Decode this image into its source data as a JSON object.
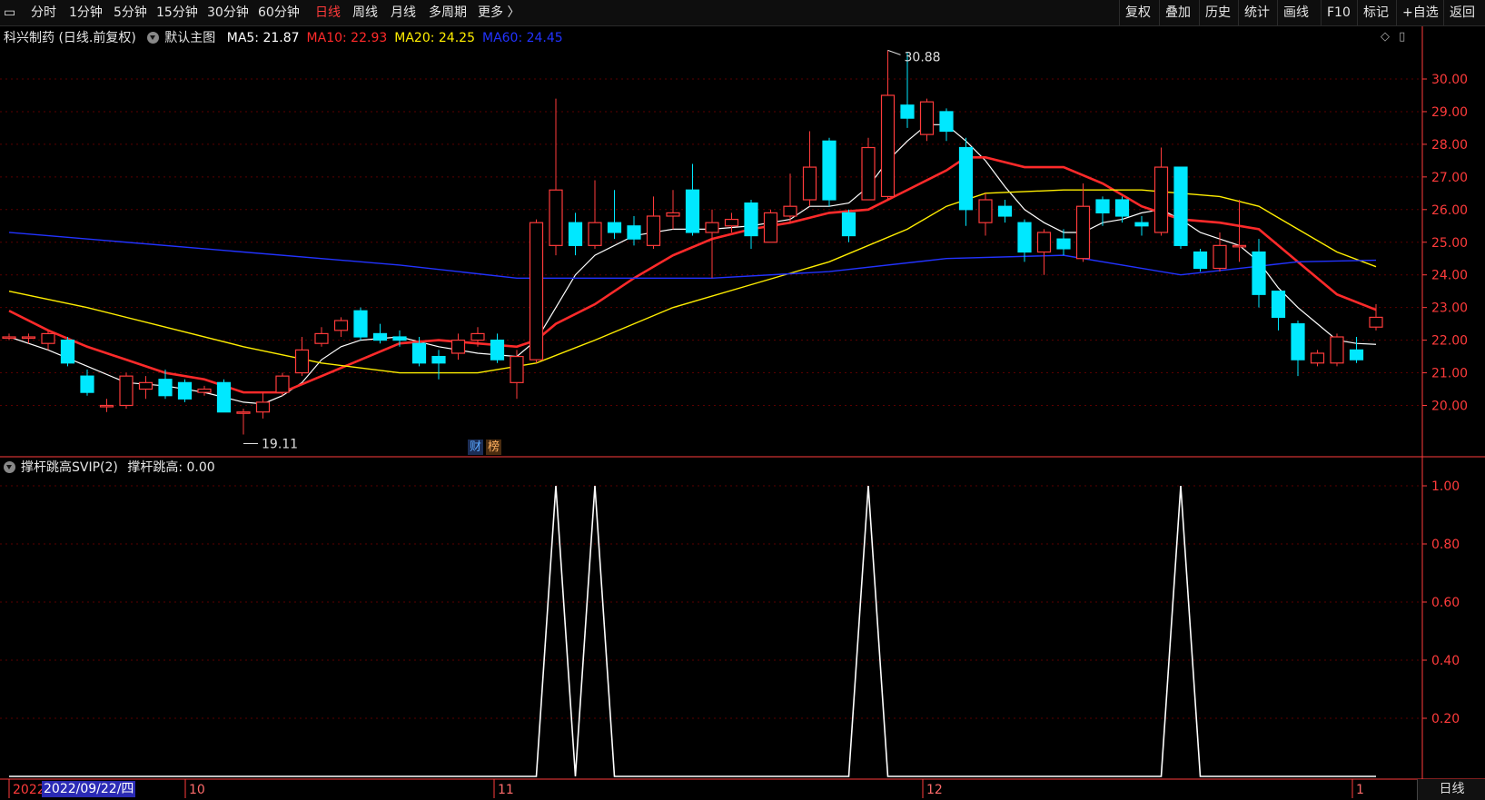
{
  "toolbar": {
    "periods": [
      {
        "label": "分时",
        "active": false
      },
      {
        "label": "1分钟",
        "active": false
      },
      {
        "label": "5分钟",
        "active": false
      },
      {
        "label": "15分钟",
        "active": false
      },
      {
        "label": "30分钟",
        "active": false
      },
      {
        "label": "60分钟",
        "active": false
      },
      {
        "label": "日线",
        "active": true
      },
      {
        "label": "周线",
        "active": false
      },
      {
        "label": "月线",
        "active": false
      },
      {
        "label": "多周期",
        "active": false
      },
      {
        "label": "更多 〉",
        "active": false
      }
    ],
    "actions": [
      "复权",
      "叠加",
      "历史",
      "统计",
      "画线",
      "F10",
      "标记",
      "+自选",
      "返回"
    ]
  },
  "main_panel": {
    "stock_title": "科兴制药 (日线.前复权)",
    "template": "默认主图",
    "indicators": [
      {
        "text": "MA5: 21.87",
        "color": "#ffffff"
      },
      {
        "text": "MA10: 22.93",
        "color": "#ff2a2a"
      },
      {
        "text": "MA20: 24.25",
        "color": "#ffee00"
      },
      {
        "text": "MA60: 24.45",
        "color": "#2233ff"
      }
    ],
    "high_label": "30.88",
    "low_label": "19.11",
    "badges": [
      {
        "text": "财",
        "color": "#3399ff"
      },
      {
        "text": "榜",
        "color": "#ff9933"
      }
    ]
  },
  "sub_panel": {
    "title": "撑杆跳高SVIP(2)",
    "value_text": "撑杆跳高: 0.00"
  },
  "x_axis": {
    "labels": [
      "2022",
      "10",
      "11",
      "12",
      "1"
    ],
    "cursor_date": "2022/09/22/四",
    "period_tag": "日线"
  },
  "colors": {
    "up": "#ff3b3b",
    "down": "#00e8ff",
    "ma5": "#ffffff",
    "ma10": "#ff2a2a",
    "ma20": "#ffee00",
    "ma60": "#2233ff",
    "grid": "#5a0000",
    "axis": "#ff3b3b"
  },
  "chart_data": [
    {
      "type": "candlestick",
      "title": "科兴制药 (日线.前复权)",
      "ylim": [
        19.0,
        31.0
      ],
      "y_ticks": [
        20.0,
        21.0,
        22.0,
        23.0,
        24.0,
        25.0,
        26.0,
        27.0,
        28.0,
        29.0,
        30.0
      ],
      "candles": [
        [
          22.1,
          22.1,
          22.2,
          22.0
        ],
        [
          22.1,
          22.1,
          22.2,
          21.9
        ],
        [
          21.9,
          22.2,
          22.3,
          21.7
        ],
        [
          22.0,
          21.3,
          22.1,
          21.2
        ],
        [
          20.9,
          20.4,
          21.1,
          20.3
        ],
        [
          20.0,
          20.0,
          20.2,
          19.8
        ],
        [
          20.0,
          20.9,
          21.0,
          19.9
        ],
        [
          20.5,
          20.7,
          20.9,
          20.2
        ],
        [
          20.8,
          20.3,
          21.1,
          20.2
        ],
        [
          20.7,
          20.2,
          20.8,
          20.1
        ],
        [
          20.4,
          20.5,
          20.6,
          20.3
        ],
        [
          20.7,
          19.8,
          20.8,
          19.8
        ],
        [
          19.8,
          19.8,
          19.9,
          19.11
        ],
        [
          19.8,
          20.1,
          20.4,
          19.6
        ],
        [
          20.4,
          20.9,
          21.0,
          20.3
        ],
        [
          21.0,
          21.7,
          22.1,
          20.9
        ],
        [
          21.9,
          22.2,
          22.4,
          21.8
        ],
        [
          22.3,
          22.6,
          22.7,
          22.1
        ],
        [
          22.9,
          22.1,
          23.0,
          22.0
        ],
        [
          22.2,
          22.0,
          22.5,
          21.9
        ],
        [
          22.1,
          22.0,
          22.3,
          21.8
        ],
        [
          21.9,
          21.3,
          22.1,
          21.2
        ],
        [
          21.5,
          21.3,
          21.7,
          20.8
        ],
        [
          21.6,
          22.0,
          22.2,
          21.4
        ],
        [
          22.0,
          22.2,
          22.4,
          21.8
        ],
        [
          22.0,
          21.4,
          22.2,
          21.3
        ],
        [
          20.7,
          21.5,
          21.7,
          20.2
        ],
        [
          21.4,
          25.6,
          25.7,
          21.3
        ],
        [
          24.9,
          26.6,
          29.4,
          24.6
        ],
        [
          25.6,
          24.9,
          25.9,
          24.6
        ],
        [
          24.9,
          25.6,
          26.9,
          24.8
        ],
        [
          25.6,
          25.3,
          26.6,
          25.1
        ],
        [
          25.5,
          25.1,
          25.8,
          24.9
        ],
        [
          24.9,
          25.8,
          26.4,
          24.8
        ],
        [
          25.8,
          25.9,
          26.6,
          25.4
        ],
        [
          26.6,
          25.3,
          27.4,
          25.2
        ],
        [
          25.3,
          25.6,
          26.0,
          23.9
        ],
        [
          25.5,
          25.7,
          25.9,
          25.3
        ],
        [
          26.2,
          25.2,
          26.3,
          24.8
        ],
        [
          25.0,
          25.9,
          26.0,
          25.0
        ],
        [
          25.8,
          26.1,
          27.1,
          25.6
        ],
        [
          26.3,
          27.3,
          28.4,
          26.1
        ],
        [
          28.1,
          26.3,
          28.2,
          26.1
        ],
        [
          25.9,
          25.2,
          26.0,
          25.0
        ],
        [
          26.3,
          27.9,
          28.2,
          26.3
        ],
        [
          26.4,
          29.5,
          30.88,
          26.3
        ],
        [
          29.2,
          28.8,
          30.8,
          28.5
        ],
        [
          28.3,
          29.3,
          29.4,
          28.1
        ],
        [
          29.0,
          28.4,
          29.1,
          28.1
        ],
        [
          27.9,
          26.0,
          28.2,
          25.5
        ],
        [
          25.6,
          26.3,
          26.5,
          25.2
        ],
        [
          26.1,
          25.8,
          26.3,
          25.6
        ],
        [
          25.6,
          24.7,
          25.7,
          24.4
        ],
        [
          24.7,
          25.3,
          25.4,
          24.0
        ],
        [
          25.1,
          24.8,
          25.4,
          24.6
        ],
        [
          24.5,
          26.1,
          26.8,
          24.4
        ],
        [
          26.3,
          25.9,
          26.4,
          25.5
        ],
        [
          26.3,
          25.8,
          26.4,
          25.6
        ],
        [
          25.6,
          25.5,
          25.8,
          25.2
        ],
        [
          25.3,
          27.3,
          27.9,
          25.2
        ],
        [
          27.3,
          24.9,
          27.3,
          24.8
        ],
        [
          24.7,
          24.2,
          24.8,
          24.1
        ],
        [
          24.2,
          24.9,
          25.3,
          24.1
        ],
        [
          24.9,
          24.9,
          26.3,
          24.4
        ],
        [
          24.7,
          23.4,
          25.1,
          23.0
        ],
        [
          23.5,
          22.7,
          23.5,
          22.3
        ],
        [
          22.5,
          21.4,
          22.6,
          20.9
        ],
        [
          21.3,
          21.6,
          21.7,
          21.2
        ],
        [
          21.3,
          22.1,
          22.2,
          21.2
        ],
        [
          21.7,
          21.4,
          22.1,
          21.3
        ],
        [
          22.4,
          22.7,
          23.1,
          22.3
        ]
      ],
      "series": [
        {
          "name": "MA5",
          "values": [
            [
              0,
              22.1
            ],
            [
              2,
              21.7
            ],
            [
              4,
              21.2
            ],
            [
              6,
              20.7
            ],
            [
              8,
              20.6
            ],
            [
              10,
              20.4
            ],
            [
              12,
              20.1
            ],
            [
              13,
              20.05
            ],
            [
              14,
              20.3
            ],
            [
              15,
              20.7
            ],
            [
              16,
              21.4
            ],
            [
              17,
              21.8
            ],
            [
              18,
              22.0
            ],
            [
              20,
              22.1
            ],
            [
              22,
              21.8
            ],
            [
              24,
              21.6
            ],
            [
              26,
              21.5
            ],
            [
              27,
              22.0
            ],
            [
              28,
              23.0
            ],
            [
              29,
              24.0
            ],
            [
              30,
              24.6
            ],
            [
              32,
              25.2
            ],
            [
              34,
              25.4
            ],
            [
              36,
              25.4
            ],
            [
              38,
              25.5
            ],
            [
              40,
              25.7
            ],
            [
              41,
              26.1
            ],
            [
              42,
              26.1
            ],
            [
              43,
              26.2
            ],
            [
              44,
              26.7
            ],
            [
              45,
              27.5
            ],
            [
              46,
              28.1
            ],
            [
              47,
              28.6
            ],
            [
              48,
              28.6
            ],
            [
              49,
              28.1
            ],
            [
              50,
              27.5
            ],
            [
              51,
              26.7
            ],
            [
              52,
              26.0
            ],
            [
              53,
              25.6
            ],
            [
              54,
              25.3
            ],
            [
              55,
              25.3
            ],
            [
              56,
              25.6
            ],
            [
              57,
              25.7
            ],
            [
              58,
              25.9
            ],
            [
              59,
              26.0
            ],
            [
              60,
              25.7
            ],
            [
              61,
              25.3
            ],
            [
              62,
              25.1
            ],
            [
              63,
              24.9
            ],
            [
              64,
              24.4
            ],
            [
              65,
              23.6
            ],
            [
              66,
              23.0
            ],
            [
              67,
              22.5
            ],
            [
              68,
              22.0
            ],
            [
              69,
              21.9
            ],
            [
              70,
              21.87
            ]
          ]
        },
        {
          "name": "MA10",
          "values": [
            [
              0,
              22.9
            ],
            [
              2,
              22.3
            ],
            [
              4,
              21.8
            ],
            [
              6,
              21.4
            ],
            [
              8,
              21.0
            ],
            [
              10,
              20.8
            ],
            [
              12,
              20.4
            ],
            [
              14,
              20.4
            ],
            [
              16,
              20.9
            ],
            [
              18,
              21.4
            ],
            [
              20,
              21.9
            ],
            [
              22,
              22.0
            ],
            [
              24,
              21.9
            ],
            [
              26,
              21.8
            ],
            [
              27,
              22.0
            ],
            [
              28,
              22.5
            ],
            [
              30,
              23.1
            ],
            [
              32,
              23.9
            ],
            [
              34,
              24.6
            ],
            [
              36,
              25.1
            ],
            [
              38,
              25.4
            ],
            [
              40,
              25.6
            ],
            [
              42,
              25.9
            ],
            [
              44,
              26.0
            ],
            [
              46,
              26.6
            ],
            [
              48,
              27.2
            ],
            [
              49,
              27.6
            ],
            [
              50,
              27.6
            ],
            [
              52,
              27.3
            ],
            [
              54,
              27.3
            ],
            [
              56,
              26.8
            ],
            [
              58,
              26.1
            ],
            [
              60,
              25.7
            ],
            [
              62,
              25.6
            ],
            [
              64,
              25.4
            ],
            [
              66,
              24.4
            ],
            [
              68,
              23.4
            ],
            [
              70,
              22.93
            ]
          ]
        },
        {
          "name": "MA20",
          "values": [
            [
              0,
              23.5
            ],
            [
              4,
              23.0
            ],
            [
              8,
              22.4
            ],
            [
              12,
              21.8
            ],
            [
              16,
              21.3
            ],
            [
              20,
              21.0
            ],
            [
              24,
              21.0
            ],
            [
              27,
              21.3
            ],
            [
              30,
              22.0
            ],
            [
              34,
              23.0
            ],
            [
              38,
              23.7
            ],
            [
              42,
              24.4
            ],
            [
              46,
              25.4
            ],
            [
              48,
              26.1
            ],
            [
              50,
              26.5
            ],
            [
              54,
              26.6
            ],
            [
              58,
              26.6
            ],
            [
              60,
              26.5
            ],
            [
              62,
              26.4
            ],
            [
              64,
              26.1
            ],
            [
              66,
              25.4
            ],
            [
              68,
              24.7
            ],
            [
              70,
              24.25
            ]
          ]
        },
        {
          "name": "MA60",
          "values": [
            [
              0,
              25.3
            ],
            [
              10,
              24.8
            ],
            [
              20,
              24.3
            ],
            [
              26,
              23.9
            ],
            [
              30,
              23.9
            ],
            [
              36,
              23.9
            ],
            [
              42,
              24.1
            ],
            [
              48,
              24.5
            ],
            [
              54,
              24.6
            ],
            [
              60,
              24.0
            ],
            [
              66,
              24.4
            ],
            [
              70,
              24.45
            ]
          ]
        }
      ]
    },
    {
      "type": "line",
      "title": "撑杆跳高SVIP(2)",
      "ylim": [
        0,
        1.05
      ],
      "y_ticks": [
        0.2,
        0.4,
        0.6,
        0.8,
        1.0
      ],
      "series": [
        {
          "name": "撑杆跳高",
          "values": [
            [
              0,
              0
            ],
            [
              26,
              0
            ],
            [
              27,
              0
            ],
            [
              28,
              1
            ],
            [
              29,
              0
            ],
            [
              30,
              1
            ],
            [
              31,
              0
            ],
            [
              43,
              0
            ],
            [
              44,
              1
            ],
            [
              45,
              0
            ],
            [
              59,
              0
            ],
            [
              60,
              1
            ],
            [
              61,
              0
            ],
            [
              70,
              0
            ]
          ]
        }
      ]
    }
  ]
}
